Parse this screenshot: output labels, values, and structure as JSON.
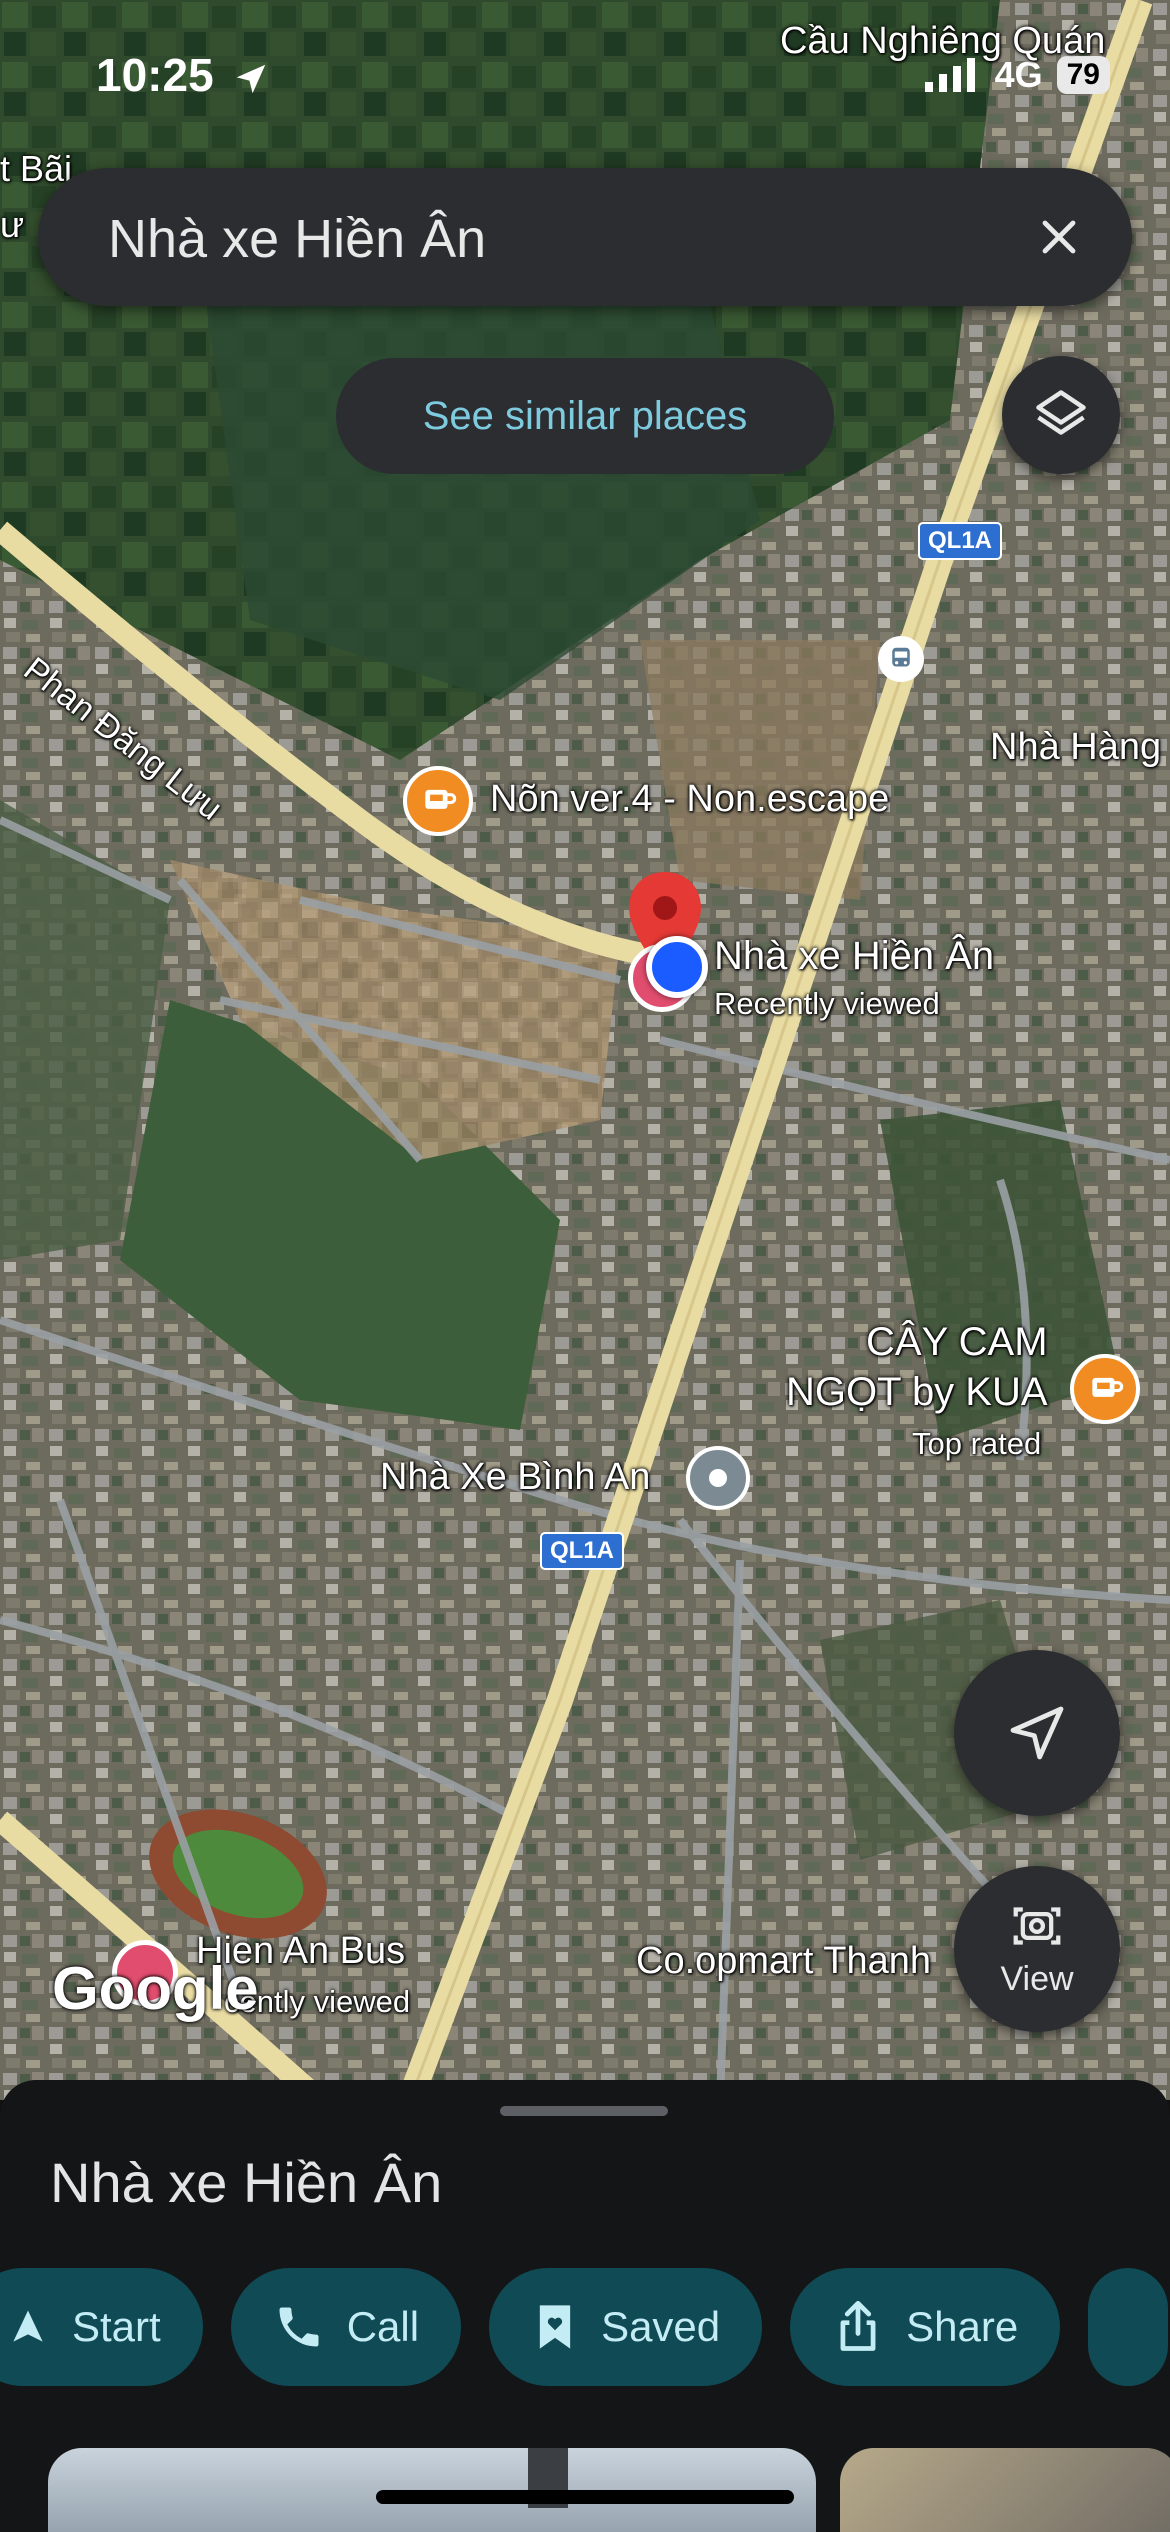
{
  "status_bar": {
    "time": "10:25",
    "network": "4G",
    "battery": "79"
  },
  "search": {
    "query": "Nhà xe Hiền Ân"
  },
  "map": {
    "similar_places_label": "See similar places",
    "google_logo": "Google",
    "view_label": "View",
    "road_labels": {
      "top_place": "Cầu Nghiêng Quán",
      "left_top": "t Bãi",
      "left_top2": "ư",
      "phan_dang_luu": "Phan Đăng Lưu",
      "nha_hang": "Nhà Hàng",
      "ql1a": "QL1A"
    },
    "places": {
      "non_escape": "Nõn ver.4 - Non.escape",
      "selected_name": "Nhà xe Hiền Ân",
      "selected_sub": "Recently viewed",
      "cay_cam_1": "CÂY CAM",
      "cay_cam_2": "NGỌT by KUA",
      "cay_cam_sub": "Top rated",
      "binh_an": "Nhà Xe Bình An",
      "hien_an_bus": "Hien An Bus",
      "hien_an_bus_sub": "cently viewed",
      "coopmart": "Co.opmart Thanh"
    },
    "icons": [
      "location-arrow-icon",
      "close-icon",
      "layers-icon",
      "navigation-icon",
      "camera-icon",
      "cafe-icon",
      "bus-icon"
    ]
  },
  "sheet": {
    "title": "Nhà xe Hiền Ân",
    "actions": [
      {
        "label": "Start",
        "icon": "directions-icon"
      },
      {
        "label": "Call",
        "icon": "phone-icon"
      },
      {
        "label": "Saved",
        "icon": "bookmark-icon"
      },
      {
        "label": "Share",
        "icon": "share-icon"
      }
    ]
  },
  "colors": {
    "sheet_bg": "#141517",
    "chip_bg": "#0f4a55",
    "chip_text": "#c4ecf4",
    "accent_link": "#7ecbe0",
    "pin_red": "#e53935",
    "location_blue": "#1a5cff"
  }
}
